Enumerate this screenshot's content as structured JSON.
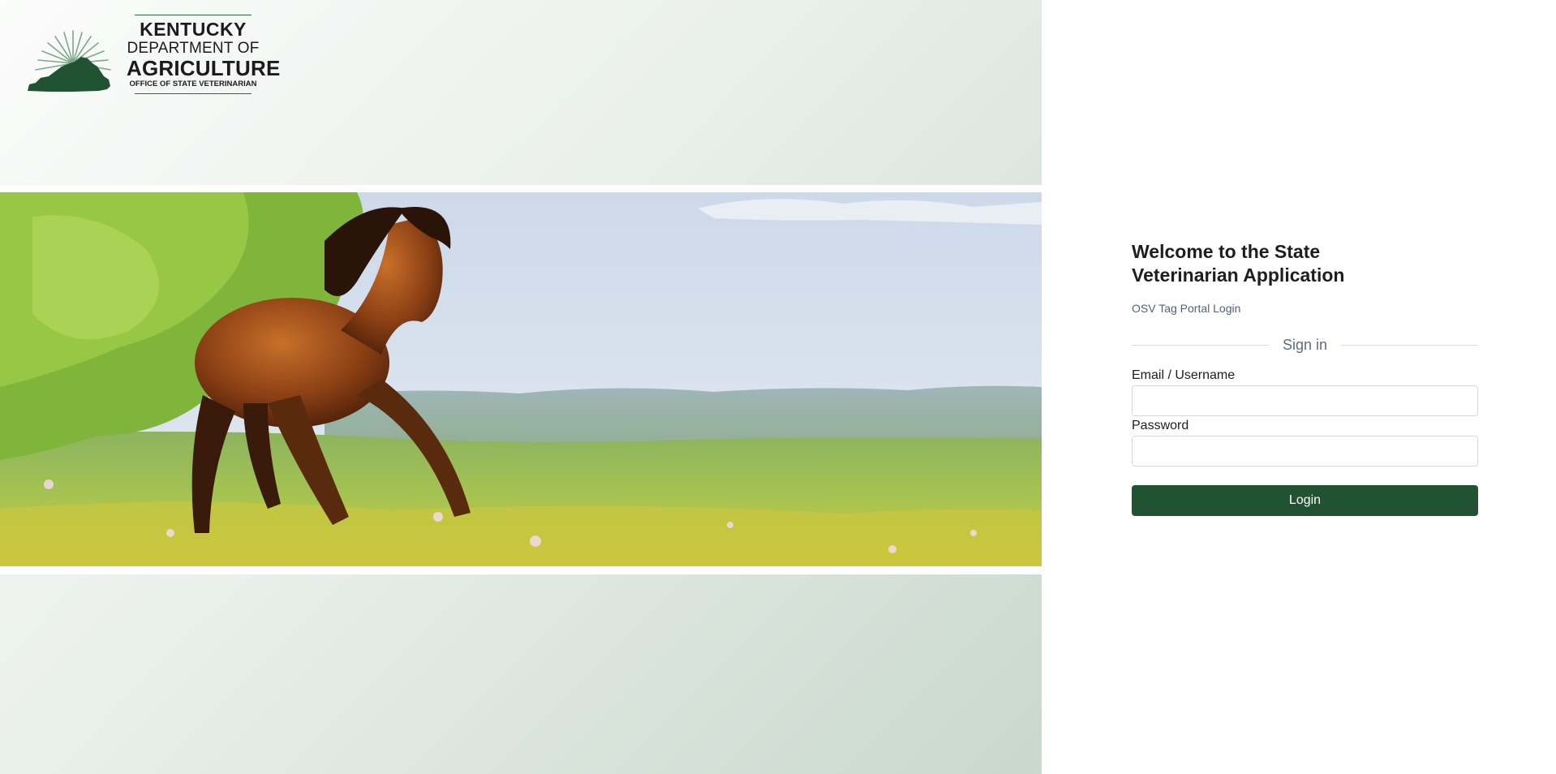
{
  "logo": {
    "line1": "KENTUCKY",
    "line2": "DEPARTMENT OF",
    "line3": "AGRICULTURE",
    "line4": "OFFICE OF STATE VETERINARIAN",
    "brand_color": "#215333"
  },
  "hero": {
    "image_subject": "horse-running-in-meadow"
  },
  "login": {
    "title": "Welcome to the State Veterinarian Application",
    "subtitle": "OSV Tag Portal Login",
    "divider_label": "Sign in",
    "email_label": "Email / Username",
    "email_value": "",
    "password_label": "Password",
    "password_value": "",
    "button_label": "Login",
    "button_color": "#215333"
  }
}
